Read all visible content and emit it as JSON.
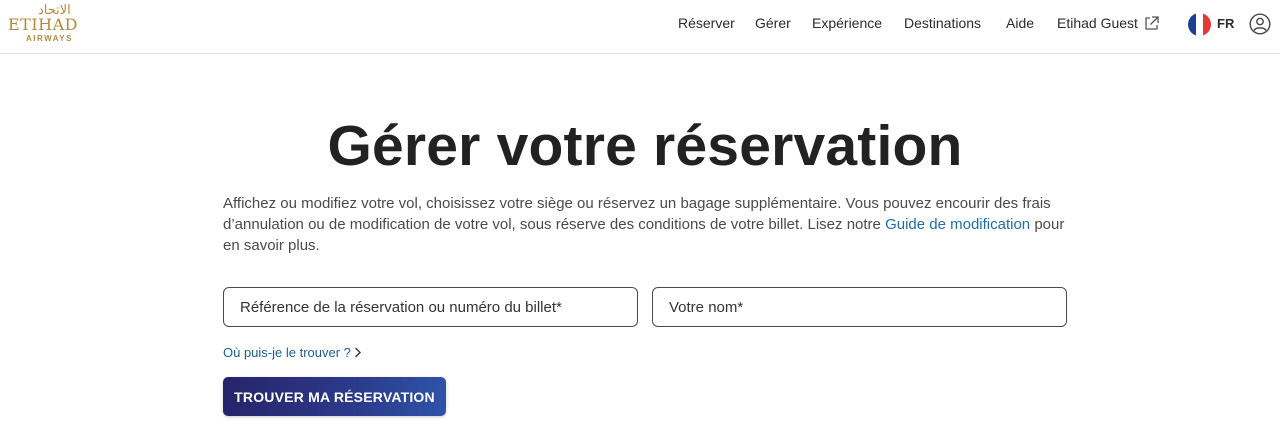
{
  "header": {
    "logo": {
      "arabic": "الاتحاد",
      "main": "ETIHAD",
      "sub": "AIRWAYS"
    },
    "nav": [
      {
        "label": "Réserver"
      },
      {
        "label": "Gérer"
      },
      {
        "label": "Expérience"
      },
      {
        "label": "Destinations"
      },
      {
        "label": "Aide"
      },
      {
        "label": "Etihad Guest"
      }
    ],
    "external_icon": "external-link-icon",
    "language": "FR",
    "flag_colors": [
      "#1f3f95",
      "#ffffff",
      "#e53935"
    ],
    "user_icon": "user-icon"
  },
  "main": {
    "title": "Gérer votre réservation",
    "description_text": "Affichez ou modifiez votre vol, choisissez votre siège ou réservez un bagage supplémentaire. Vous pouvez encourir des frais d’annulation ou de modification de votre vol, sous réserve des conditions de votre billet. Lisez notre ",
    "description_link": "Guide de modification",
    "description_tail": " pour en savoir plus.",
    "ref_field": {
      "placeholder": "Référence de la réservation ou numéro du billet*",
      "value": ""
    },
    "name_field": {
      "placeholder": "Votre nom*",
      "value": ""
    },
    "help_link": "Où puis-je le trouver ?",
    "submit_label": "TROUVER MA RÉSERVATION",
    "colors": {
      "button_start": "#27246a",
      "button_end": "#2f53a8",
      "link": "#1c6fa8",
      "gold": "#b38a3d"
    }
  }
}
